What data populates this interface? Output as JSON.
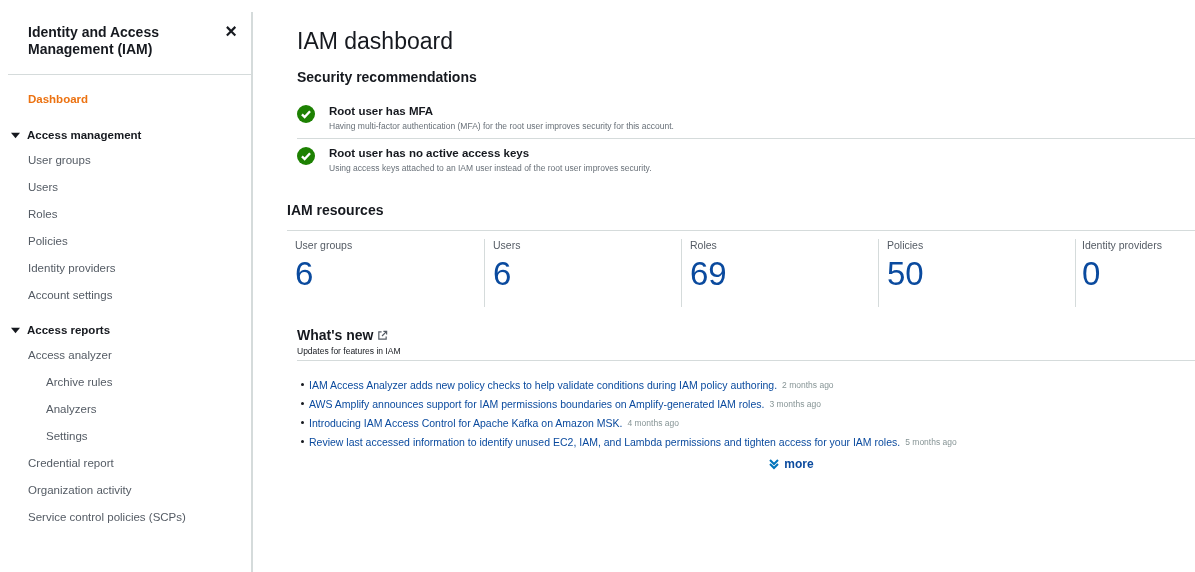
{
  "sidebar": {
    "title": "Identity and Access Management (IAM)",
    "close": "×",
    "items": [
      {
        "label": "Dashboard",
        "kind": "link",
        "selected": true
      },
      {
        "label": "Access management",
        "kind": "group",
        "expanded": true,
        "children": [
          {
            "label": "User groups",
            "selected": false
          },
          {
            "label": "Users",
            "selected": false
          },
          {
            "label": "Roles",
            "selected": false
          },
          {
            "label": "Policies",
            "selected": false
          },
          {
            "label": "Identity providers",
            "selected": false
          },
          {
            "label": "Account settings",
            "selected": false
          }
        ]
      },
      {
        "label": "Access reports",
        "kind": "group",
        "expanded": true,
        "children": [
          {
            "label": "Access analyzer",
            "selected": false,
            "children": [
              {
                "label": "Archive rules",
                "selected": false
              },
              {
                "label": "Analyzers",
                "selected": false
              },
              {
                "label": "Settings",
                "selected": false
              }
            ]
          },
          {
            "label": "Credential report",
            "selected": false
          },
          {
            "label": "Organization activity",
            "selected": false
          },
          {
            "label": "Service control policies (SCPs)",
            "selected": false
          }
        ]
      }
    ]
  },
  "page_title": "IAM dashboard",
  "security": {
    "heading": "Security recommendations",
    "items": [
      {
        "title": "Root user has MFA",
        "description": "Having multi-factor authentication (MFA) for the root user improves security for this account.",
        "passed": true
      },
      {
        "title": "Root user has no active access keys",
        "description": "Using access keys attached to an IAM user instead of the root user improves security.",
        "passed": true
      }
    ]
  },
  "resources": {
    "heading": "IAM resources",
    "items": [
      {
        "label": "User groups",
        "count": "6"
      },
      {
        "label": "Users",
        "count": "6"
      },
      {
        "label": "Roles",
        "count": "69"
      },
      {
        "label": "Policies",
        "count": "50"
      },
      {
        "label": "Identity providers",
        "count": "0"
      }
    ]
  },
  "whats_new": {
    "heading": "What's new",
    "subtitle": "Updates for features in IAM",
    "items": [
      {
        "text": "IAM Access Analyzer adds new policy checks to help validate conditions during IAM policy authoring.",
        "age": "2 months ago"
      },
      {
        "text": "AWS Amplify announces support for IAM permissions boundaries on Amplify-generated IAM roles.",
        "age": "3 months ago"
      },
      {
        "text": "Introducing IAM Access Control for Apache Kafka on Amazon MSK.",
        "age": "4 months ago"
      },
      {
        "text": "Review last accessed information to identify unused EC2, IAM, and Lambda permissions and tighten access for your IAM roles.",
        "age": "5 months ago"
      }
    ],
    "more": "more"
  }
}
